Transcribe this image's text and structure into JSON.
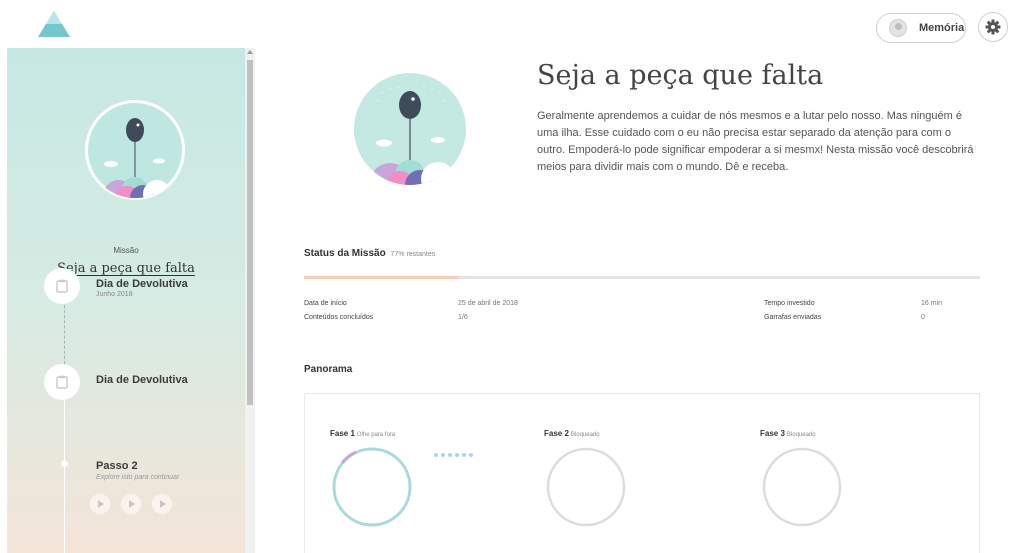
{
  "topbar": {
    "memoria_label": "Memória"
  },
  "sidebar": {
    "mission_label": "Missão",
    "mission_title": "Seja a peça que falta",
    "timeline": [
      {
        "title": "Dia de Devolutiva",
        "subtitle": "Junho 2018",
        "icon": "clipboard-icon"
      },
      {
        "title": "Dia de Devolutiva",
        "subtitle": "",
        "icon": "clipboard-icon"
      },
      {
        "title": "Passo 2",
        "subtitle": "Explore isto para continuar",
        "icon": ""
      }
    ],
    "play_buttons": 3
  },
  "main": {
    "title": "Seja a peça que falta",
    "description": "Geralmente aprendemos a cuidar de nós mesmos e a lutar pelo nosso. Mas ninguém é uma ilha. Esse cuidado com o eu não precisa estar separado da atenção para com o outro. Empoderá-lo pode significar empoderar a si mesmx! Nesta missão você descobrirá meios para dividir mais com o mundo. Dê e receba.",
    "status": {
      "heading": "Status da Missão",
      "remaining": "77% restantes",
      "progress_fraction": 0.23
    },
    "stats": {
      "start_label": "Data de início",
      "start_value": "25 de abril de 2018",
      "contents_label": "Conteúdos concluídos",
      "contents_value": "1/6",
      "time_label": "Tempo investido",
      "time_value": "16 min",
      "bottles_label": "Garrafas enviadas",
      "bottles_value": "0"
    },
    "panorama": {
      "heading": "Panorama",
      "phases": [
        {
          "name": "Fase 1",
          "sub": "Olhe para fora",
          "active": true
        },
        {
          "name": "Fase 2",
          "sub": "Bloqueado",
          "active": false
        },
        {
          "name": "Fase 3",
          "sub": "Bloqueado",
          "active": false
        }
      ]
    }
  },
  "colors": {
    "sidebar_top": "#c6e8e3",
    "sidebar_bottom": "#f4e4d8",
    "progress_fill": "#f3cdb8",
    "ring_active": "#a9d9df",
    "ring_inactive": "#dcdcdc"
  }
}
